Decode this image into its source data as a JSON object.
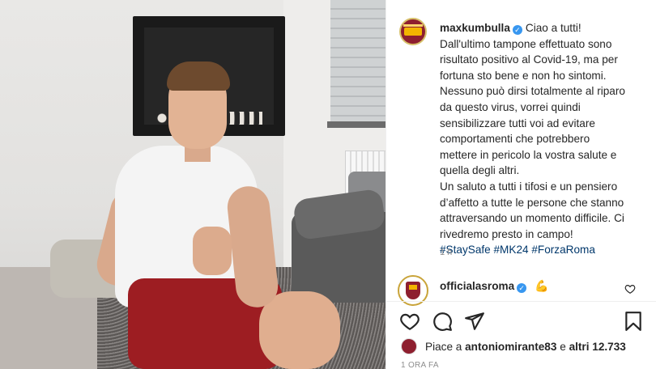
{
  "post": {
    "username": "maxkumbulla",
    "caption_lines": [
      "Ciao a tutti!",
      "Dall'ultimo tampone effettuato sono",
      "risultato positivo al Covid-19, ma per",
      "fortuna sto bene e non ho sintomi.",
      "Nessuno può dirsi totalmente al riparo",
      "da questo virus, vorrei quindi",
      "sensibilizzare tutti voi ad evitare",
      "comportamenti che potrebbero",
      "mettere in pericolo la vostra salute e",
      "quella degli altri.",
      "Un saluto a tutti i tifosi e un pensiero",
      "d’affetto a tutte le persone che stanno",
      "attraversando un momento difficile. Ci",
      "rivedremo presto in campo!",
      "#StaySafe #MK24 #ForzaRoma"
    ],
    "caption_time": "1 h",
    "verified_mark": "✓"
  },
  "comment": {
    "username": "officialasroma",
    "emoji": "💪",
    "verified_mark": "✓"
  },
  "likes": {
    "prefix": "Piace a",
    "user": "antoniomirante83",
    "connector": "e",
    "others": "altri 12.733"
  },
  "timestamp": "1 ORA FA",
  "icons": {
    "like": "heart-icon",
    "comment": "comment-icon",
    "share": "paper-plane-icon",
    "save": "bookmark-icon",
    "comment_like": "heart-icon"
  },
  "colors": {
    "verified": "#3897f0",
    "hashtag": "#00376b",
    "roma": "#8e1f2f",
    "roma_gold": "#f2b400"
  }
}
